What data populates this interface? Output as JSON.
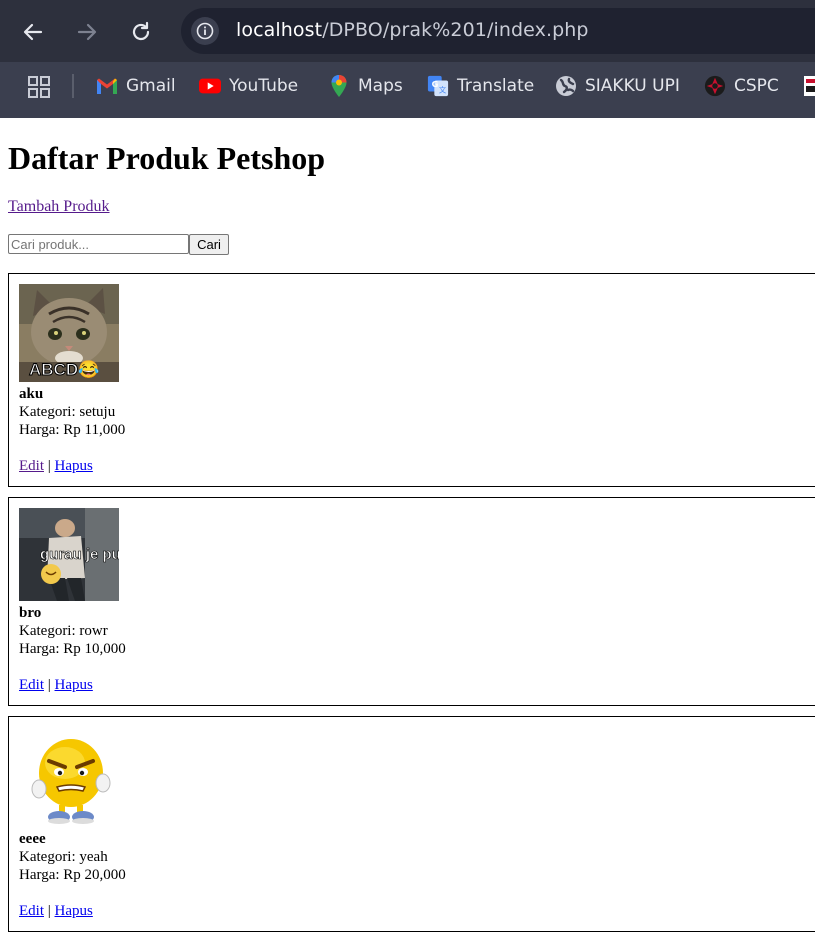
{
  "browser": {
    "url_host": "localhost",
    "url_path": "/DPBO/prak%201/index.php",
    "bookmarks": [
      {
        "label": "Gmail",
        "icon": "gmail-icon"
      },
      {
        "label": "YouTube",
        "icon": "youtube-icon"
      },
      {
        "label": "Maps",
        "icon": "maps-icon"
      },
      {
        "label": "Translate",
        "icon": "translate-icon"
      },
      {
        "label": "SIAKKU UPI",
        "icon": "globe-icon"
      },
      {
        "label": "CSPC",
        "icon": "cspc-icon"
      }
    ]
  },
  "page": {
    "title": "Daftar Produk Petshop",
    "add_link": "Tambah Produk",
    "search_placeholder": "Cari produk...",
    "search_button": "Cari"
  },
  "products": [
    {
      "name": "aku",
      "category": "Kategori: setuju",
      "price": "Harga: Rp 11,000",
      "image_caption": "ABCD😂"
    },
    {
      "name": "bro",
      "category": "Kategori: rowr",
      "price": "Harga: Rp 10,000",
      "image_caption": "gurau je pun"
    },
    {
      "name": "eeee",
      "category": "Kategori: yeah",
      "price": "Harga: Rp 20,000",
      "image_caption": ""
    }
  ],
  "actions": {
    "edit": "Edit",
    "separator": "|",
    "delete": "Hapus"
  }
}
